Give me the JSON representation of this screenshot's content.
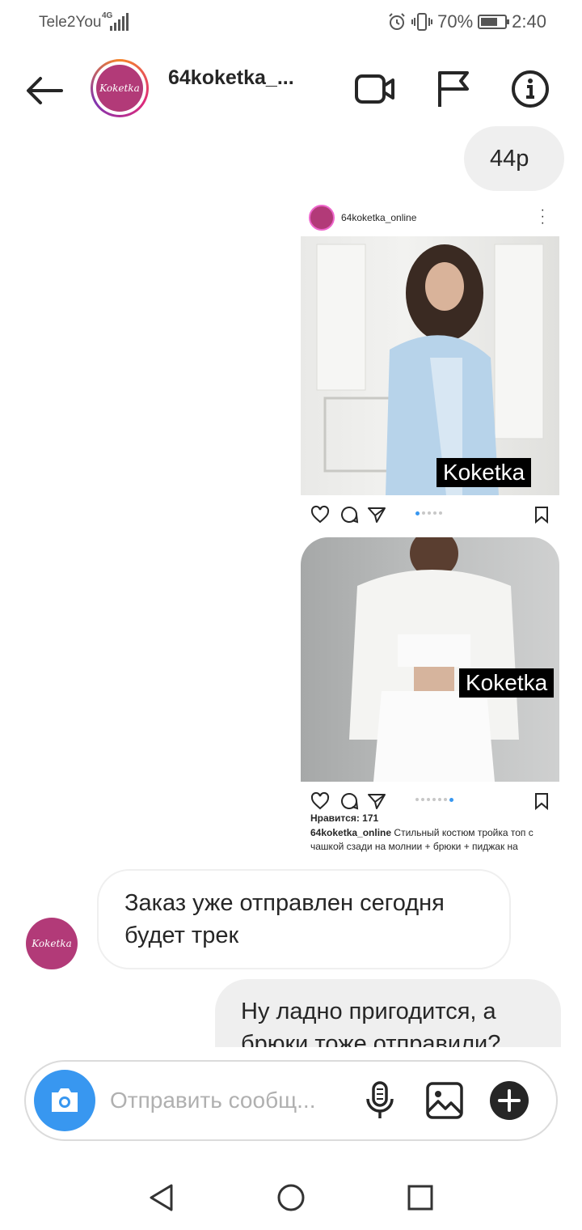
{
  "status_bar": {
    "carrier": "Tele2You",
    "network": "4G",
    "battery_percent": "70%",
    "battery_level": 0.7,
    "time": "2:40"
  },
  "header": {
    "title": "64koketka_...",
    "avatar_text": "Koketka"
  },
  "messages": {
    "price_reply": "44р",
    "shared_post": {
      "username": "64koketka_online",
      "watermark": "Koketka",
      "likes": "Нравится: 171",
      "caption_user": "64koketka_online",
      "caption_text": "Стильный костюм тройка топ с чашкой сзади на молнии + брюки + пиджак на"
    },
    "order_sent_line1": "Заказ уже отправлен сегодня",
    "order_sent_line2": "будет трек",
    "reply_line1": "Ну ладно пригодится, а",
    "reply_line2": "брюки тоже отправили?"
  },
  "composer": {
    "placeholder": "Отправить сообщ..."
  },
  "icons": {
    "back": "arrow-left-icon",
    "video_call": "video-camera-icon",
    "report": "flag-icon",
    "info": "info-icon",
    "camera": "camera-icon",
    "mic": "microphone-icon",
    "gallery": "image-icon",
    "add": "plus-icon"
  },
  "colors": {
    "brand": "#b23a78",
    "accent": "#3897f0",
    "bubble_mine": "#efefef"
  }
}
